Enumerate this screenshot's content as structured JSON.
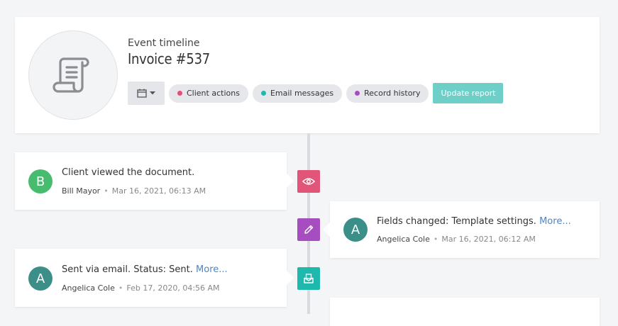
{
  "header": {
    "subtitle": "Event timeline",
    "title": "Invoice #537",
    "document_icon": "scroll-document-icon",
    "calendar_icon": "calendar-icon",
    "filters": [
      {
        "label": "Client actions",
        "color": "#e0507a"
      },
      {
        "label": "Email messages",
        "color": "#1fb8ad"
      },
      {
        "label": "Record history",
        "color": "#a64ec0"
      }
    ],
    "update_label": "Update report"
  },
  "events": [
    {
      "title": "Client viewed the document.",
      "more": "",
      "author": "Bill Mayor",
      "time": "Mar 16, 2021, 06:13 AM",
      "initial": "B",
      "avatar_color": "#48bc6e",
      "marker_color": "#e05578",
      "marker_icon": "eye-icon"
    },
    {
      "title": "Fields changed: Template settings.",
      "more": "More...",
      "author": "Angelica Cole",
      "time": "Mar 16, 2021, 06:12 AM",
      "initial": "A",
      "avatar_color": "#3b8f88",
      "marker_color": "#a64ec0",
      "marker_icon": "pencil-icon"
    },
    {
      "title": "Sent via email. Status: Sent.",
      "more": "More...",
      "author": "Angelica Cole",
      "time": "Feb 17, 2020, 04:56 AM",
      "initial": "A",
      "avatar_color": "#3b8f88",
      "marker_color": "#1fb8ad",
      "marker_icon": "email-icon"
    }
  ],
  "separator": "•"
}
